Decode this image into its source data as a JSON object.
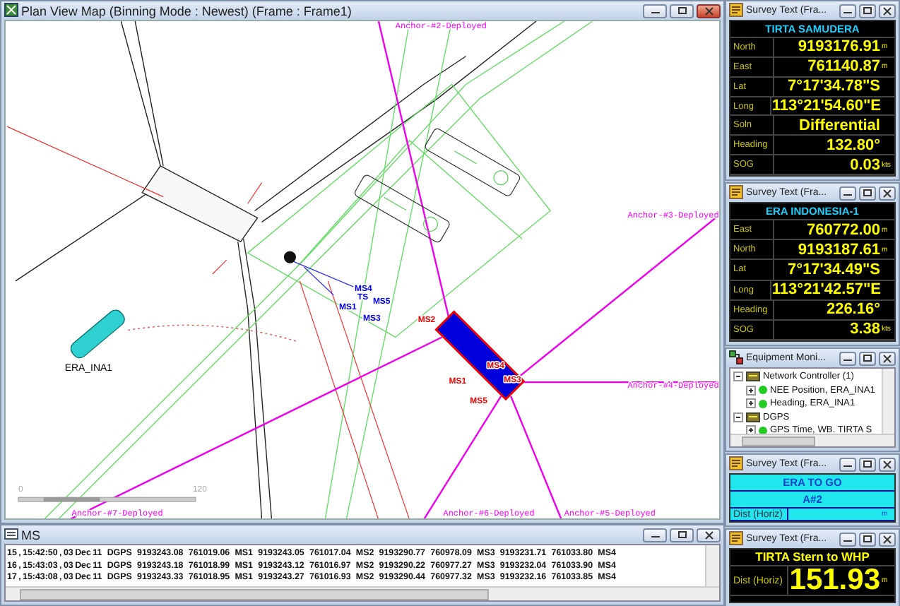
{
  "map_window": {
    "title": "Plan View Map (Binning Mode : Newest)  (Frame : Frame1)",
    "active": true,
    "labels": [
      {
        "text": "Anchor-#2-Deployed",
        "kind": "anchor"
      },
      {
        "text": "Anchor-#3-Deployed",
        "kind": "anchor"
      },
      {
        "text": "Anchor-#4-Deployed",
        "kind": "anchor"
      },
      {
        "text": "Anchor-#7-Deployed",
        "kind": "anchor"
      },
      {
        "text": "Anchor-#6-Deployed",
        "kind": "anchor"
      },
      {
        "text": "Anchor-#5-Deployed",
        "kind": "anchor"
      },
      {
        "text": "ERA_INA1",
        "kind": "vessel"
      },
      {
        "text": "MS4",
        "kind": "blue"
      },
      {
        "text": "TS",
        "kind": "blue"
      },
      {
        "text": "MS1",
        "kind": "blue"
      },
      {
        "text": "MS5",
        "kind": "blue"
      },
      {
        "text": "MS3",
        "kind": "blue"
      },
      {
        "text": "MS2",
        "kind": "red"
      },
      {
        "text": "MS4",
        "kind": "red"
      },
      {
        "text": "MS1",
        "kind": "red"
      },
      {
        "text": "MS3",
        "kind": "red"
      },
      {
        "text": "MS5",
        "kind": "red"
      },
      {
        "text": "0",
        "kind": "scale"
      },
      {
        "text": "120",
        "kind": "scale"
      }
    ]
  },
  "log_window": {
    "title": "MS",
    "active": false,
    "rows": [
      "15 , 15:42:50 , 03 Dec 11   DGPS   9193243.08   761019.06   MS1   9193243.05   761017.04   MS2   9193290.77   760978.09   MS3   9193231.71   761033.80   MS4",
      "16 , 15:43:03 , 03 Dec 11   DGPS   9193243.18   761018.99   MS1   9193243.12   761016.97   MS2   9193290.22   760977.27   MS3   9193232.04   761033.90   MS4",
      "17 , 15:43:08 , 03 Dec 11   DGPS   9193243.33   761018.95   MS1   9193243.27   761016.93   MS2   9193290.44   760977.32   MS3   9193232.16   761033.85   MS4"
    ]
  },
  "panels": [
    {
      "kind": "survey",
      "title": "Survey Text (Fra...",
      "active": false,
      "heading": "TIRTA SAMUDERA",
      "fields": [
        {
          "label": "North",
          "value": "9193176.91",
          "unit": "m"
        },
        {
          "label": "East",
          "value": "761140.87",
          "unit": "m"
        },
        {
          "label": "Lat",
          "value": "7°17'34.78\"S"
        },
        {
          "label": "Long",
          "value": "113°21'54.60\"E"
        },
        {
          "label": "Soln",
          "value": "Differential"
        },
        {
          "label": "Heading",
          "value": "132.80°"
        },
        {
          "label": "SOG",
          "value": "0.03",
          "unit": "kts"
        }
      ]
    },
    {
      "kind": "survey",
      "title": "Survey Text (Fra...",
      "active": false,
      "heading": "ERA INDONESIA-1",
      "fields": [
        {
          "label": "East",
          "value": "760772.00",
          "unit": "m"
        },
        {
          "label": "North",
          "value": "9193187.61",
          "unit": "m"
        },
        {
          "label": "Lat",
          "value": "7°17'34.49\"S"
        },
        {
          "label": "Long",
          "value": "113°21'42.57\"E"
        },
        {
          "label": "Heading",
          "value": "226.16°"
        },
        {
          "label": "SOG",
          "value": "3.38",
          "unit": "kts"
        }
      ]
    },
    {
      "kind": "equipment",
      "title": "Equipment Moni...",
      "active": false,
      "tree": [
        {
          "label": "Network Controller (1)",
          "expanded": true,
          "children": [
            {
              "label": "NEE Position, ERA_INA1",
              "expanded": false,
              "color": "#22cc22"
            },
            {
              "label": "Heading, ERA_INA1",
              "expanded": false,
              "color": "#22cc22"
            }
          ]
        },
        {
          "label": "DGPS",
          "expanded": true,
          "children": [
            {
              "label": "GPS Time, WB. TIRTA S",
              "expanded": false,
              "color": "#22cc22"
            }
          ]
        }
      ]
    },
    {
      "kind": "target",
      "title": "Survey Text (Fra...",
      "active": false,
      "heading": "ERA TO GO",
      "subheading": "A#2",
      "fields": [
        {
          "label": "Dist (Horiz)",
          "unit": "m"
        }
      ]
    },
    {
      "kind": "survey",
      "title": "Survey Text (Fra...",
      "active": false,
      "heading": "TIRTA Stern to WHP",
      "fields": [
        {
          "label": "Dist (Horiz)",
          "value": "151.93",
          "unit": "m"
        }
      ]
    }
  ]
}
